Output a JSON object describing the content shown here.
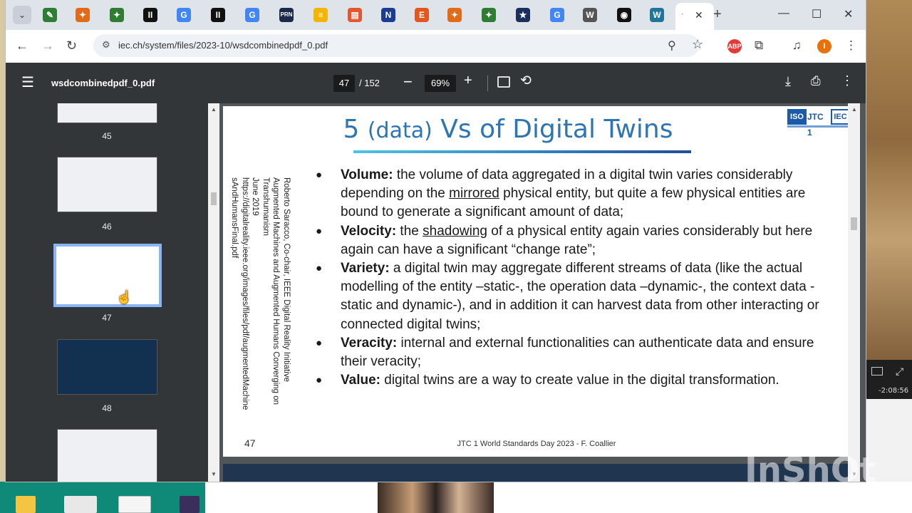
{
  "browser": {
    "url": "iec.ch/system/files/2023-10/wsdcombinedpdf_0.pdf",
    "tabs": [
      {
        "icon": "feather-icon",
        "color": "#2e7d32",
        "glyph": "✎"
      },
      {
        "icon": "extension-icon",
        "color": "#e06c1a",
        "glyph": "✦"
      },
      {
        "icon": "extension-icon",
        "color": "#2e7d32",
        "glyph": "✦"
      },
      {
        "icon": "pause-icon",
        "color": "#111111",
        "glyph": "II"
      },
      {
        "icon": "google-icon",
        "color": "#4285f4",
        "glyph": "G"
      },
      {
        "icon": "pause-icon",
        "color": "#111111",
        "glyph": "II"
      },
      {
        "icon": "google-icon",
        "color": "#4285f4",
        "glyph": "G"
      },
      {
        "icon": "prn-icon",
        "color": "#1b2a4a",
        "glyph": "PRN"
      },
      {
        "icon": "notes-icon",
        "color": "#f4b400",
        "glyph": "≡"
      },
      {
        "icon": "slides-icon",
        "color": "#e4572e",
        "glyph": "▤"
      },
      {
        "icon": "n-icon",
        "color": "#1a3d8f",
        "glyph": "N"
      },
      {
        "icon": "e-icon",
        "color": "#e2561f",
        "glyph": "E"
      },
      {
        "icon": "extension-icon",
        "color": "#e06c1a",
        "glyph": "✦"
      },
      {
        "icon": "extension-icon",
        "color": "#2e7d32",
        "glyph": "✦"
      },
      {
        "icon": "star-box-icon",
        "color": "#1a2f5a",
        "glyph": "★"
      },
      {
        "icon": "google-icon",
        "color": "#4285f4",
        "glyph": "G"
      },
      {
        "icon": "wikipedia-icon",
        "color": "#555555",
        "glyph": "W"
      },
      {
        "icon": "github-icon",
        "color": "#111111",
        "glyph": "◉"
      },
      {
        "icon": "wordpress-icon",
        "color": "#21759b",
        "glyph": "W"
      }
    ],
    "profile_initial": "I",
    "abp_label": "ABP"
  },
  "pdf": {
    "filename": "wsdcombinedpdf_0.pdf",
    "current_page": "47",
    "total_pages": "/ 152",
    "zoom": "69%",
    "thumbnails": [
      {
        "label": "45"
      },
      {
        "label": "46"
      },
      {
        "label": "47"
      },
      {
        "label": "48"
      }
    ]
  },
  "slide": {
    "title_pre": "5 ",
    "title_small": "(data)",
    "title_post": " Vs of Digital Twins",
    "logo": {
      "iso": "ISO",
      "jtc": "JTC 1",
      "iec": "IEC"
    },
    "vertical_note": [
      "Roberto Saracco, Co-chair, IEEE Digital Reality Initiative",
      "Augmented Machines and Augmented Humans Converging on",
      "Transhumanism",
      "June 2019",
      "https://digitalreality.ieee.org/images/files/pdf/augmentedMachine",
      "sAndHumansFinal.pdf"
    ],
    "bullets": [
      {
        "term": "Volume:",
        "a": " the volume of data aggregated in a digital twin varies considerably depending on the ",
        "u": "mirrored",
        "b": " physical entity, but quite a few physical entities are bound to generate a significant amount of data;"
      },
      {
        "term": "Velocity:",
        "a": " the ",
        "u": "shadowing",
        "b": " of a physical entity again varies considerably but here again can have a significant “change rate”;"
      },
      {
        "term": "Variety:",
        "a": " a digital twin may aggregate different streams of data (like the actual modelling of the entity –static-, the operation data –dynamic-, the context data -static and dynamic-), and in addition it can harvest data from other interacting or connected digital twins;",
        "u": "",
        "b": ""
      },
      {
        "term": "Veracity:",
        "a": " internal and external functionalities can authenticate data and ensure their veracity;",
        "u": "",
        "b": ""
      },
      {
        "term": "Value:",
        "a": " digital twins are a way to create value in the digital transformation.",
        "u": "",
        "b": ""
      }
    ],
    "page_number": "47",
    "footer": "JTC 1 World Standards Day 2023 - F. Coallier"
  },
  "overlay": {
    "video_time": "-2:08:56",
    "watermark": "InShOt"
  }
}
